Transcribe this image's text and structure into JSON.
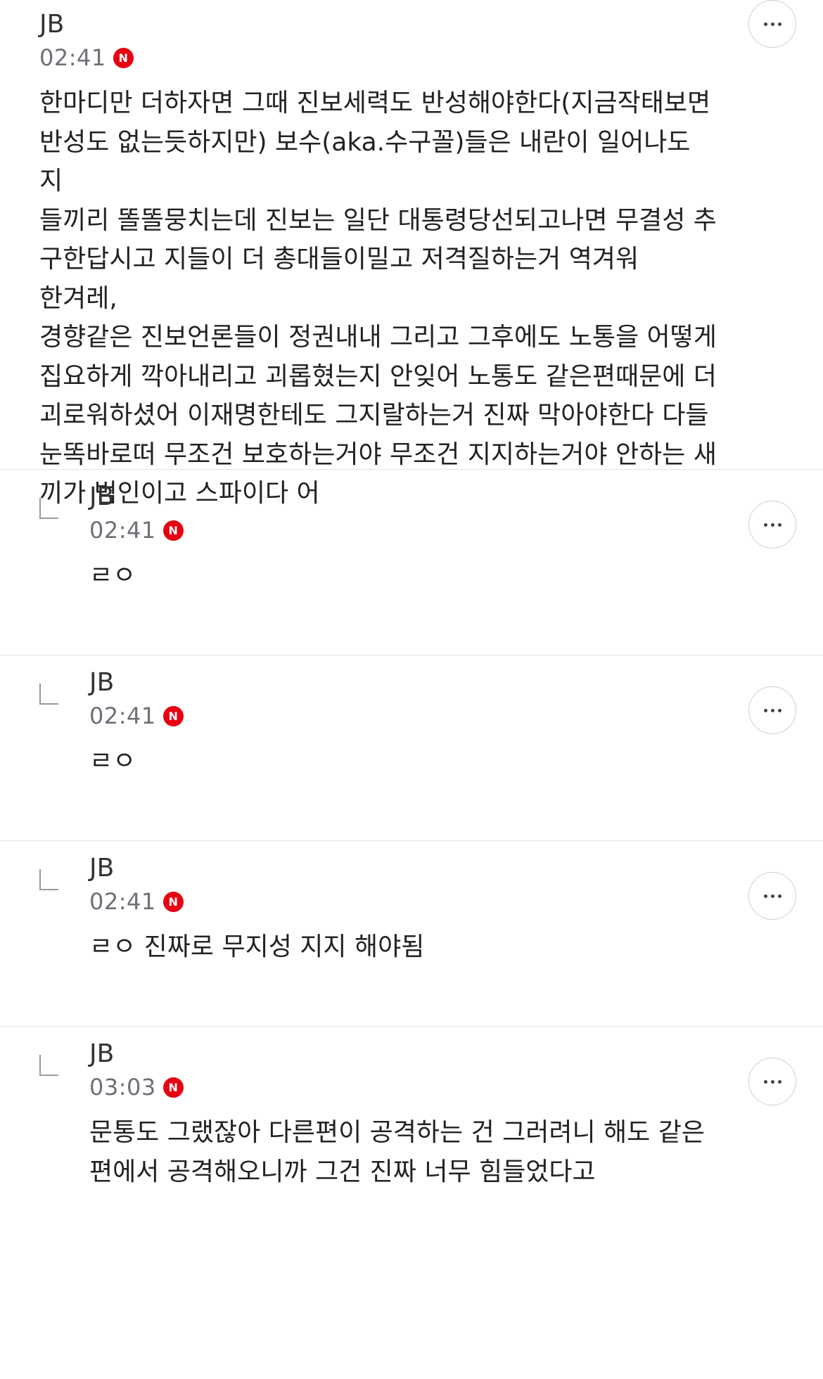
{
  "comments": [
    {
      "author": "JB",
      "time": "02:41",
      "badge": "N",
      "text": "한마디만 더하자면 그때 진보세력도 반성해야한다(지금작태보면\n반성도 없는듯하지만) 보수(aka.수구꼴)들은 내란이 일어나도 지\n들끼리 똘똘뭉치는데 진보는 일단 대통령당선되고나면 무결성 추\n구한답시고 지들이 더 총대들이밀고 저격질하는거 역겨워 한겨레,\n경향같은 진보언론들이 정권내내 그리고 그후에도 노통을 어떻게\n집요하게 깍아내리고 괴롭혔는지 안잊어 노통도 같은편때문에 더\n괴로워하셨어 이재명한테도 그지랄하는거 진짜 막아야한다 다들\n눈똑바로떠 무조건 보호하는거야 무조건 지지하는거야 안하는 새\n끼가 범인이고 스파이다 어"
    },
    {
      "author": "JB",
      "time": "02:41",
      "badge": "N",
      "text": "ㄹㅇ"
    },
    {
      "author": "JB",
      "time": "02:41",
      "badge": "N",
      "text": "ㄹㅇ"
    },
    {
      "author": "JB",
      "time": "02:41",
      "badge": "N",
      "text": "ㄹㅇ 진짜로 무지성 지지 해야됨"
    },
    {
      "author": "JB",
      "time": "03:03",
      "badge": "N",
      "text": "문통도 그랬잖아 다른편이 공격하는 건 그러려니 해도 같은\n편에서 공격해오니까 그건 진짜 너무 힘들었다고"
    }
  ],
  "colors": {
    "badge": "#e60012",
    "time": "#6c7079",
    "divider": "#e4e4e4"
  },
  "icons": {
    "more": "more-options-icon",
    "reply": "reply-indent-icon",
    "badge": "naver-n-icon"
  }
}
